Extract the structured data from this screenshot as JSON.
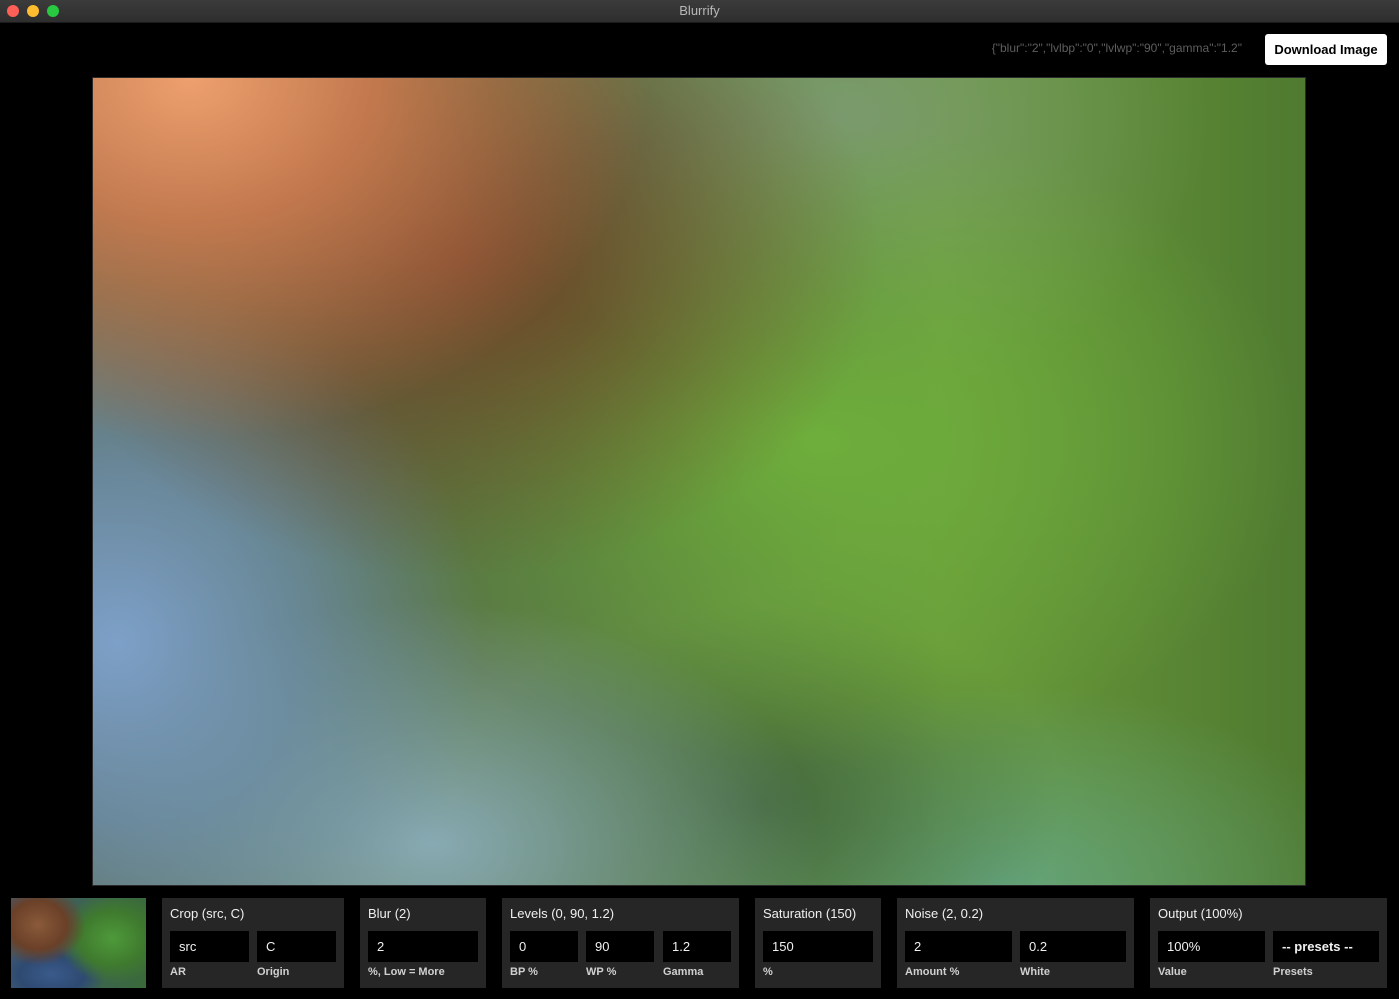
{
  "window": {
    "title": "Blurrify"
  },
  "toolbar": {
    "settings_json": "{\"blur\":\"2\",\"lvlbp\":\"0\",\"lvlwp\":\"90\",\"gamma\":\"1.2\"",
    "download_label": "Download Image"
  },
  "panels": {
    "crop": {
      "title": "Crop (src, C)",
      "ar_value": "src",
      "ar_label": "AR",
      "origin_value": "C",
      "origin_label": "Origin"
    },
    "blur": {
      "title": "Blur (2)",
      "value": "2",
      "label": "%, Low = More"
    },
    "levels": {
      "title": "Levels (0, 90, 1.2)",
      "bp_value": "0",
      "bp_label": "BP %",
      "wp_value": "90",
      "wp_label": "WP %",
      "gamma_value": "1.2",
      "gamma_label": "Gamma"
    },
    "saturation": {
      "title": "Saturation (150)",
      "value": "150",
      "label": "%"
    },
    "noise": {
      "title": "Noise (2, 0.2)",
      "amount_value": "2",
      "amount_label": "Amount %",
      "white_value": "0.2",
      "white_label": "White"
    },
    "output": {
      "title": "Output (100%)",
      "value": "100%",
      "value_label": "Value",
      "presets_selected": "-- presets --",
      "presets_label": "Presets"
    }
  }
}
